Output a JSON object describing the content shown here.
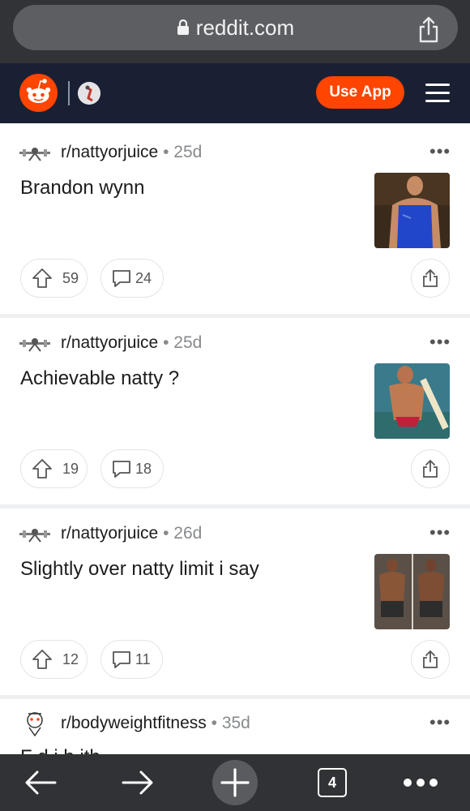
{
  "browser": {
    "url": "reddit.com",
    "tabs_count": "4"
  },
  "header": {
    "use_app_label": "Use App",
    "accent": "#ff4500"
  },
  "posts": [
    {
      "subreddit": "r/nattyorjuice",
      "dot": "•",
      "age": "25d",
      "title": "Brandon wynn",
      "votes": "59",
      "comments": "24",
      "more": "•••"
    },
    {
      "subreddit": "r/nattyorjuice",
      "dot": "•",
      "age": "25d",
      "title": "Achievable natty ?",
      "votes": "19",
      "comments": "18",
      "more": "•••"
    },
    {
      "subreddit": "r/nattyorjuice",
      "dot": "•",
      "age": "26d",
      "title": "Slightly over natty limit i say",
      "votes": "12",
      "comments": "11",
      "more": "•••"
    },
    {
      "subreddit": "r/bodyweightfitness",
      "dot": "•",
      "age": "35d",
      "title": "F d   i b   ith",
      "votes": "",
      "comments": "",
      "more": "•••"
    }
  ],
  "icons": [
    "lock-icon",
    "share-icon",
    "reddit-snoo-icon",
    "menu-icon",
    "upvote-icon",
    "comment-icon",
    "back-icon",
    "forward-icon",
    "new-tab-icon",
    "tabs-icon",
    "more-icon"
  ]
}
